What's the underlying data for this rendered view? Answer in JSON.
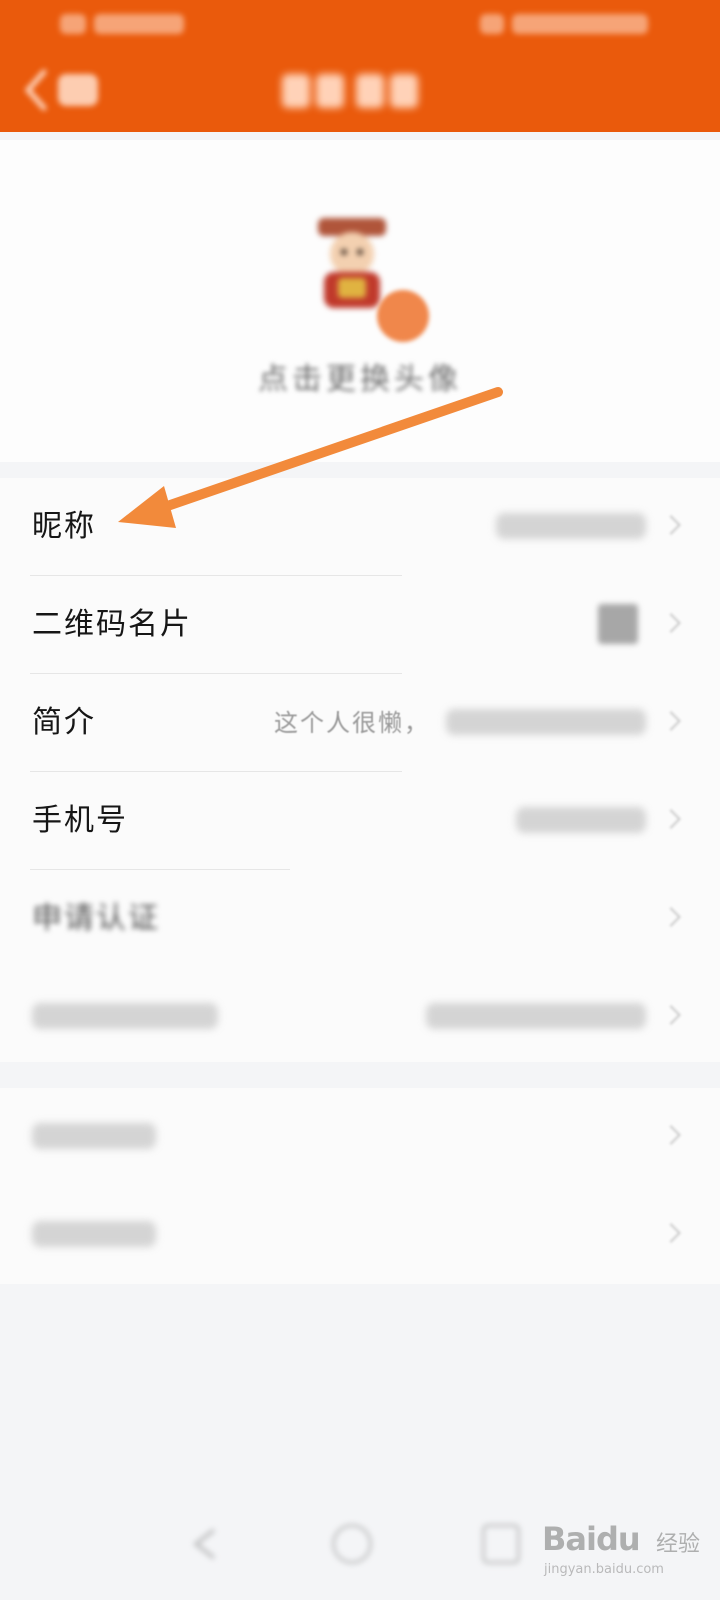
{
  "colors": {
    "header": "#ea5a0c",
    "arrow": "#f28a3b",
    "background": "#f4f5f7"
  },
  "header": {
    "back_icon": "chevron-left-icon"
  },
  "profile": {
    "avatar_icon": "avatar-image",
    "badge_icon": "camera-badge-icon",
    "change_avatar_hint": "点击更换头像"
  },
  "settings_rows": [
    {
      "label": "昵称",
      "value": ""
    },
    {
      "label": "二维码名片",
      "value": ""
    },
    {
      "label": "简介",
      "value": "这个人很懒，"
    },
    {
      "label": "手机号",
      "value": ""
    },
    {
      "label": "申请认证",
      "value": ""
    }
  ],
  "watermark": {
    "brand": "Baidu",
    "tag": "经验",
    "url": "jingyan.baidu.com"
  }
}
